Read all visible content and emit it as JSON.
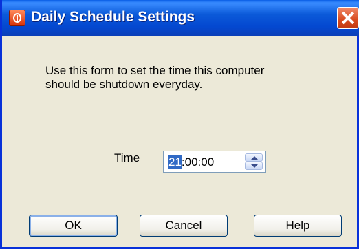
{
  "window": {
    "title": "Daily Schedule Settings",
    "app_icon": "power-icon",
    "close_icon": "close-icon"
  },
  "form": {
    "description": "Use this form to set the time this computer\nshould be shutdown everyday.",
    "time_label": "Time",
    "time_value": {
      "hours": "21",
      "rest": ":00:00"
    }
  },
  "buttons": {
    "ok": "OK",
    "cancel": "Cancel",
    "help": "Help"
  },
  "colors": {
    "titlebar": "#0b5ad9",
    "window_bg": "#ece9d8",
    "close_button": "#d84a1e",
    "selection": "#316ac5"
  }
}
